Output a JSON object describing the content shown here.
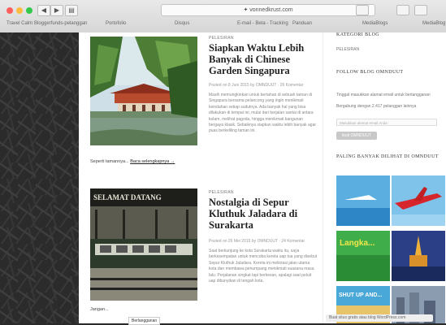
{
  "browser": {
    "url": "✦ vonnedkrust.com",
    "bookmarks": [
      "Travel Calm",
      "Bloggerfunds-pelanggan",
      "Portofolio",
      "Disqus",
      "E-mail - Beta - Tracking",
      "Panduan",
      "MediaBlogs",
      "MediaBlog"
    ]
  },
  "posts": [
    {
      "category": "PELESIRAN",
      "title": "Siapkan Waktu Lebih Banyak di Chinese Garden Singapura",
      "meta": "Posted on 8 Juni 2015 by OMNDUUT · 26 Komentar",
      "excerpt": "Masih memungkinkan untuk bertahan di sebuah taman di Singapura bersama pelancong yang ingin menikmati keindahan setiap sudutnya. Ada banyak hal yang bisa dilakukan di tempat ini, mulai dari berjalan santai di antara kolam, melihat pagoda, hingga menikmati bangunan bergaya klasik. Sebaiknya siapkan waktu lebih banyak agar puas berkeliling taman ini.",
      "read_more_prefix": "Seperti tamannya...",
      "read_more": "Baca selengkapnya →"
    },
    {
      "category": "PELESIRAN",
      "title": "Nostalgia di Sepur Kluthuk Jaladara di Surakarta",
      "meta": "Posted on 26 Mei 2015 by OMNDUUT · 24 Komentar",
      "excerpt": "Saat berkunjung ke kota Surakarta waktu itu, saya berkesempatan untuk mencoba kereta uap tua yang disebut Sepur Kluthuk Jaladara. Kereta ini melintasi jalan utama kota dan membawa penumpang menikmati suasana masa lalu. Perjalanan singkat tapi berkesan, apalagi saat peluit uap dibunyikan di tengah kota.",
      "read_more_prefix": "Jangan...",
      "read_more": "Baca selengkapnya →"
    }
  ],
  "sidebar": {
    "top_label": "KATEGORI BLOG",
    "top_item": "PELESIRAN",
    "follow_title": "FOLLOW BLOG OMNDUUT",
    "follow_text1": "Tinggal masukkan alamat email untuk berlangganan",
    "follow_text2": "Bergabung dengan 2.417 pelanggan lainnya",
    "email_placeholder": "Masukkan alamat email Anda",
    "follow_button": "Ikuti OMNDUUT",
    "popular_title": "PALING BANYAK DILIHAT DI OMNDUUT",
    "tiles": [
      "",
      "",
      "Langka...",
      "",
      "SHUT UP AND...",
      ""
    ]
  },
  "bottom_popup": "Berlangganan",
  "status_text": "Buat situs gratis atau blog WordPress.com"
}
